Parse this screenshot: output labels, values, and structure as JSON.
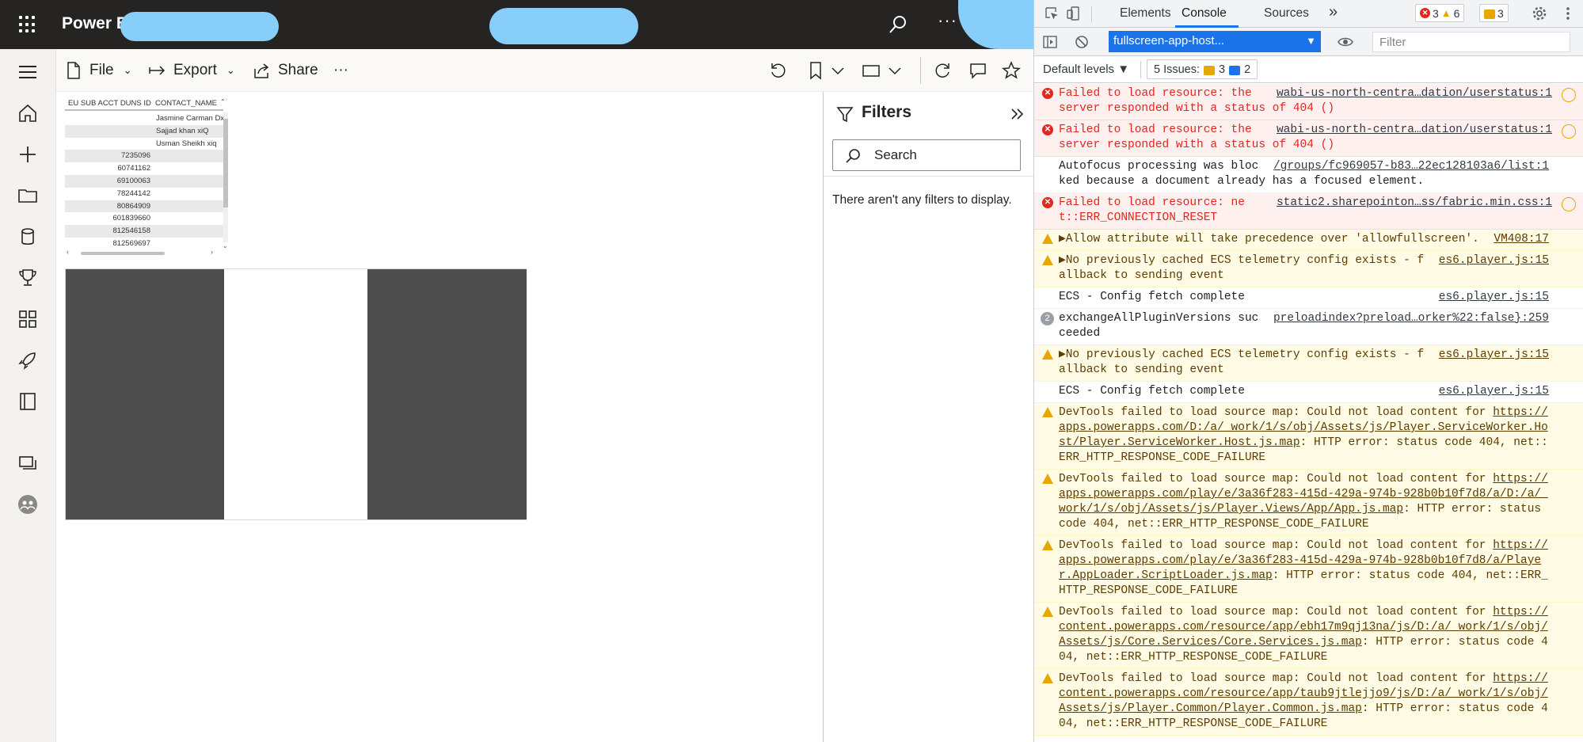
{
  "powerbi": {
    "app_title": "Power BI",
    "more_label": "···",
    "commands": {
      "file": "File",
      "export": "Export",
      "share": "Share",
      "more": "···"
    },
    "table_visual": {
      "headers": [
        "EU SUB ACCT DUNS ID",
        "CONTACT_NAME"
      ],
      "rows": [
        [
          "",
          "Jasmine Carman Dxi"
        ],
        [
          "",
          "Sajjad khan xiQ"
        ],
        [
          "",
          "Usman Sheikh xiq"
        ],
        [
          "7235096",
          ""
        ],
        [
          "60741162",
          ""
        ],
        [
          "69100063",
          ""
        ],
        [
          "78244142",
          ""
        ],
        [
          "80864909",
          ""
        ],
        [
          "601839660",
          ""
        ],
        [
          "812546158",
          ""
        ],
        [
          "812569697",
          ""
        ]
      ]
    },
    "filters": {
      "title": "Filters",
      "search_placeholder": "Search",
      "empty_message": "There aren't any filters to display."
    }
  },
  "devtools": {
    "tabs": [
      "Elements",
      "Console",
      "Sources"
    ],
    "active_tab": "Console",
    "more_tabs": "»",
    "error_count": "3",
    "warning_count": "6",
    "issue_count": "3",
    "context": "fullscreen-app-host...",
    "filter_placeholder": "Filter",
    "default_levels": "Default levels ▼",
    "issues_label": "5 Issues:",
    "issues_warn": "3",
    "issues_info": "2",
    "messages": [
      {
        "level": "error",
        "text": "Failed to load resource: the server responded with a status of 404 ()",
        "source": "wabi-us-north-centra…dation/userstatus:1",
        "extra": true
      },
      {
        "level": "error",
        "text": "Failed to load resource: the server responded with a status of 404 ()",
        "source": "wabi-us-north-centra…dation/userstatus:1",
        "extra": true
      },
      {
        "level": "info",
        "text": "Autofocus processing was blocked because a document already has a focused element.",
        "source": "/groups/fc969057-b83…22ec128103a6/list:1",
        "extra": false
      },
      {
        "level": "error",
        "text": "Failed to load resource: net::ERR_CONNECTION_RESET",
        "source": "static2.sharepointon…ss/fabric.min.css:1",
        "extra": true
      },
      {
        "level": "warn",
        "text": "▶Allow attribute will take precedence over 'allowfullscreen'.",
        "source": "VM408:17",
        "extra": false
      },
      {
        "level": "warn",
        "text": "▶No previously cached ECS telemetry config exists - fallback to sending event",
        "source": "es6.player.js:15",
        "extra": false
      },
      {
        "level": "info",
        "text": "ECS - Config fetch complete",
        "source": "es6.player.js:15",
        "extra": false
      },
      {
        "level": "count",
        "count": "2",
        "text": "exchangeAllPluginVersions succeeded",
        "source": "preloadindex?preload…orker%22:false}:259",
        "extra": false
      },
      {
        "level": "warn",
        "text": "▶No previously cached ECS telemetry config exists - fallback to sending event",
        "source": "es6.player.js:15",
        "extra": false
      },
      {
        "level": "info",
        "text": "ECS - Config fetch complete",
        "source": "es6.player.js:15",
        "extra": false
      },
      {
        "level": "warn",
        "text": "DevTools failed to load source map: Could not load content for ",
        "link": "https://apps.powerapps.com/D:/a/_work/1/s/obj/Assets/js/Player.ServiceWorker.Host/Player.ServiceWorker.Host.js.map",
        "tail": ": HTTP error: status code 404, net::ERR_HTTP_RESPONSE_CODE_FAILURE",
        "source": "",
        "extra": false
      },
      {
        "level": "warn",
        "text": "DevTools failed to load source map: Could not load content for ",
        "link": "https://apps.powerapps.com/play/e/3a36f283-415d-429a-974b-928b0b10f7d8/a/D:/a/_work/1/s/obj/Assets/js/Player.Views/App/App.js.map",
        "tail": ": HTTP error: status code 404, net::ERR_HTTP_RESPONSE_CODE_FAILURE",
        "source": "",
        "extra": false
      },
      {
        "level": "warn",
        "text": "DevTools failed to load source map: Could not load content for ",
        "link": "https://apps.powerapps.com/play/e/3a36f283-415d-429a-974b-928b0b10f7d8/a/Player.AppLoader.ScriptLoader.js.map",
        "tail": ": HTTP error: status code 404, net::ERR_HTTP_RESPONSE_CODE_FAILURE",
        "source": "",
        "extra": false
      },
      {
        "level": "warn",
        "text": "DevTools failed to load source map: Could not load content for ",
        "link": "https://content.powerapps.com/resource/app/ebh17m9qj13na/js/D:/a/_work/1/s/obj/Assets/js/Core.Services/Core.Services.js.map",
        "tail": ": HTTP error: status code 404, net::ERR_HTTP_RESPONSE_CODE_FAILURE",
        "source": "",
        "extra": false
      },
      {
        "level": "warn",
        "text": "DevTools failed to load source map: Could not load content for ",
        "link": "https://content.powerapps.com/resource/app/taub9jtlejjo9/js/D:/a/_work/1/s/obj/Assets/js/Player.Common/Player.Common.js.map",
        "tail": ": HTTP error: status code 404, net::ERR_HTTP_RESPONSE_CODE_FAILURE",
        "source": "",
        "extra": false
      }
    ]
  }
}
